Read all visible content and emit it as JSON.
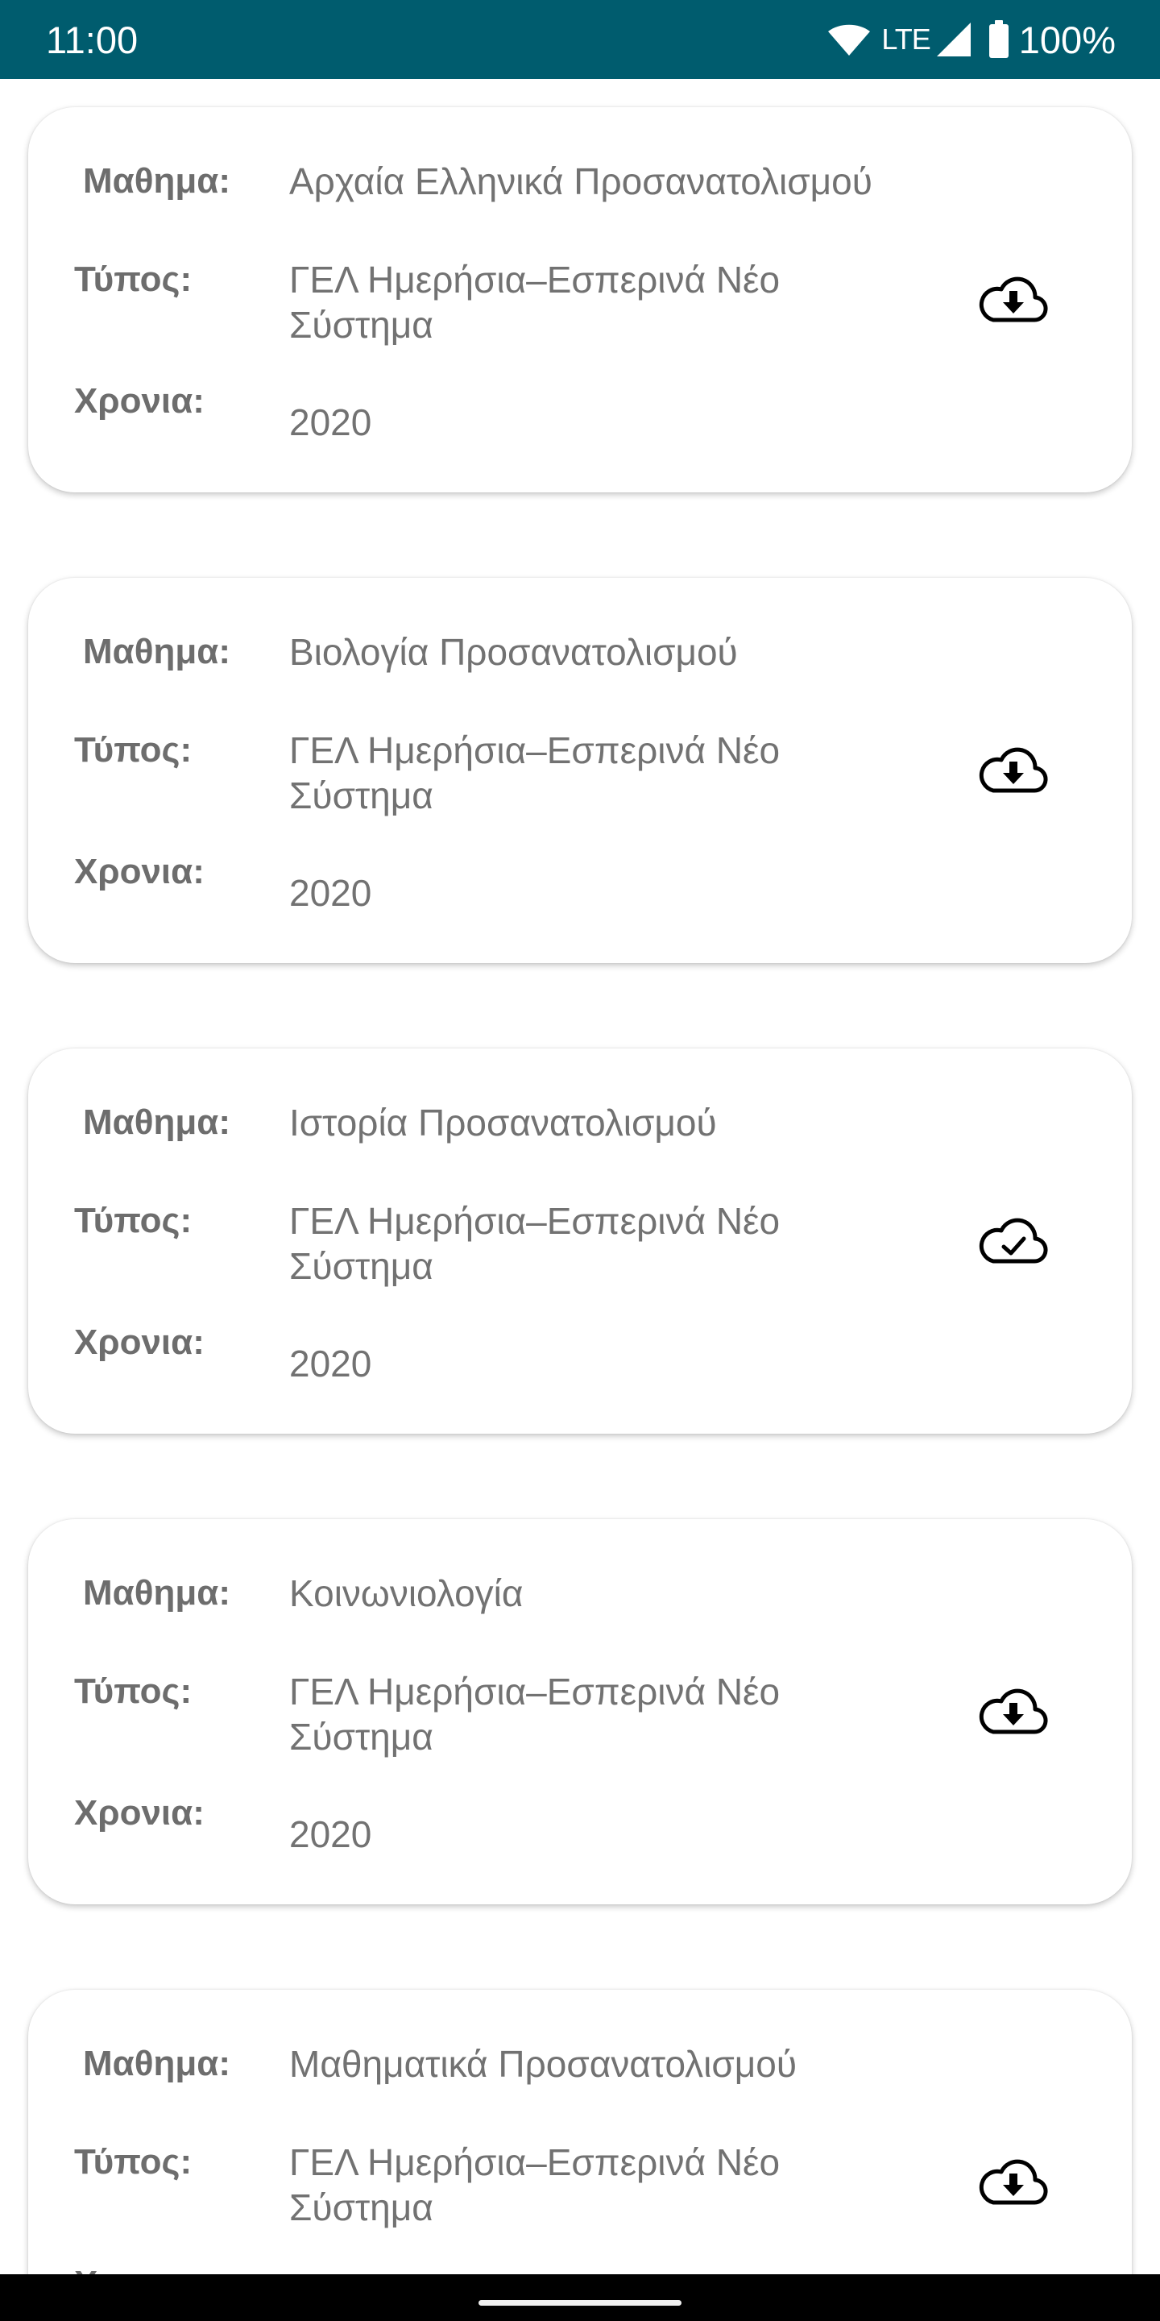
{
  "status_bar": {
    "time": "11:00",
    "network": "LTE",
    "battery": "100%"
  },
  "labels": {
    "subject": "Μαθημα:",
    "type": "Τύπος:",
    "year": "Χρονια:"
  },
  "icons": {
    "download": "cloud-download-icon",
    "downloaded": "cloud-check-icon"
  },
  "items": [
    {
      "subject": "Αρχαία Ελληνικά Προσανατολισμού",
      "type": "ΓΕΛ Ημερήσια–Εσπερινά Νέο Σύστημα",
      "year": "2020",
      "status": "download"
    },
    {
      "subject": "Βιολογία Προσανατολισμού",
      "type": "ΓΕΛ Ημερήσια–Εσπερινά Νέο Σύστημα",
      "year": "2020",
      "status": "download"
    },
    {
      "subject": "Ιστορία Προσανατολισμού",
      "type": "ΓΕΛ Ημερήσια–Εσπερινά Νέο Σύστημα",
      "year": "2020",
      "status": "downloaded"
    },
    {
      "subject": "Κοινωνιολογία",
      "type": "ΓΕΛ Ημερήσια–Εσπερινά Νέο Σύστημα",
      "year": "2020",
      "status": "download"
    },
    {
      "subject": "Μαθηματικά Προσανατολισμού",
      "type": "ΓΕΛ Ημερήσια–Εσπερινά Νέο Σύστημα",
      "year": "",
      "status": "download"
    }
  ]
}
